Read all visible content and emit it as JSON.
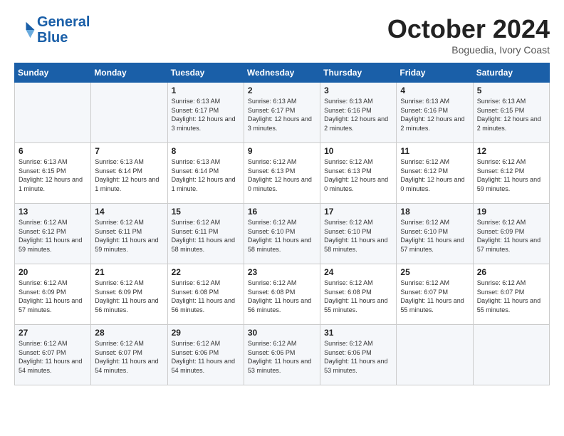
{
  "header": {
    "logo_line1": "General",
    "logo_line2": "Blue",
    "month": "October 2024",
    "location": "Boguedia, Ivory Coast"
  },
  "days_of_week": [
    "Sunday",
    "Monday",
    "Tuesday",
    "Wednesday",
    "Thursday",
    "Friday",
    "Saturday"
  ],
  "weeks": [
    [
      {
        "day": "",
        "info": ""
      },
      {
        "day": "",
        "info": ""
      },
      {
        "day": "1",
        "info": "Sunrise: 6:13 AM\nSunset: 6:17 PM\nDaylight: 12 hours and 3 minutes."
      },
      {
        "day": "2",
        "info": "Sunrise: 6:13 AM\nSunset: 6:17 PM\nDaylight: 12 hours and 3 minutes."
      },
      {
        "day": "3",
        "info": "Sunrise: 6:13 AM\nSunset: 6:16 PM\nDaylight: 12 hours and 2 minutes."
      },
      {
        "day": "4",
        "info": "Sunrise: 6:13 AM\nSunset: 6:16 PM\nDaylight: 12 hours and 2 minutes."
      },
      {
        "day": "5",
        "info": "Sunrise: 6:13 AM\nSunset: 6:15 PM\nDaylight: 12 hours and 2 minutes."
      }
    ],
    [
      {
        "day": "6",
        "info": "Sunrise: 6:13 AM\nSunset: 6:15 PM\nDaylight: 12 hours and 1 minute."
      },
      {
        "day": "7",
        "info": "Sunrise: 6:13 AM\nSunset: 6:14 PM\nDaylight: 12 hours and 1 minute."
      },
      {
        "day": "8",
        "info": "Sunrise: 6:13 AM\nSunset: 6:14 PM\nDaylight: 12 hours and 1 minute."
      },
      {
        "day": "9",
        "info": "Sunrise: 6:12 AM\nSunset: 6:13 PM\nDaylight: 12 hours and 0 minutes."
      },
      {
        "day": "10",
        "info": "Sunrise: 6:12 AM\nSunset: 6:13 PM\nDaylight: 12 hours and 0 minutes."
      },
      {
        "day": "11",
        "info": "Sunrise: 6:12 AM\nSunset: 6:12 PM\nDaylight: 12 hours and 0 minutes."
      },
      {
        "day": "12",
        "info": "Sunrise: 6:12 AM\nSunset: 6:12 PM\nDaylight: 11 hours and 59 minutes."
      }
    ],
    [
      {
        "day": "13",
        "info": "Sunrise: 6:12 AM\nSunset: 6:12 PM\nDaylight: 11 hours and 59 minutes."
      },
      {
        "day": "14",
        "info": "Sunrise: 6:12 AM\nSunset: 6:11 PM\nDaylight: 11 hours and 59 minutes."
      },
      {
        "day": "15",
        "info": "Sunrise: 6:12 AM\nSunset: 6:11 PM\nDaylight: 11 hours and 58 minutes."
      },
      {
        "day": "16",
        "info": "Sunrise: 6:12 AM\nSunset: 6:10 PM\nDaylight: 11 hours and 58 minutes."
      },
      {
        "day": "17",
        "info": "Sunrise: 6:12 AM\nSunset: 6:10 PM\nDaylight: 11 hours and 58 minutes."
      },
      {
        "day": "18",
        "info": "Sunrise: 6:12 AM\nSunset: 6:10 PM\nDaylight: 11 hours and 57 minutes."
      },
      {
        "day": "19",
        "info": "Sunrise: 6:12 AM\nSunset: 6:09 PM\nDaylight: 11 hours and 57 minutes."
      }
    ],
    [
      {
        "day": "20",
        "info": "Sunrise: 6:12 AM\nSunset: 6:09 PM\nDaylight: 11 hours and 57 minutes."
      },
      {
        "day": "21",
        "info": "Sunrise: 6:12 AM\nSunset: 6:09 PM\nDaylight: 11 hours and 56 minutes."
      },
      {
        "day": "22",
        "info": "Sunrise: 6:12 AM\nSunset: 6:08 PM\nDaylight: 11 hours and 56 minutes."
      },
      {
        "day": "23",
        "info": "Sunrise: 6:12 AM\nSunset: 6:08 PM\nDaylight: 11 hours and 56 minutes."
      },
      {
        "day": "24",
        "info": "Sunrise: 6:12 AM\nSunset: 6:08 PM\nDaylight: 11 hours and 55 minutes."
      },
      {
        "day": "25",
        "info": "Sunrise: 6:12 AM\nSunset: 6:07 PM\nDaylight: 11 hours and 55 minutes."
      },
      {
        "day": "26",
        "info": "Sunrise: 6:12 AM\nSunset: 6:07 PM\nDaylight: 11 hours and 55 minutes."
      }
    ],
    [
      {
        "day": "27",
        "info": "Sunrise: 6:12 AM\nSunset: 6:07 PM\nDaylight: 11 hours and 54 minutes."
      },
      {
        "day": "28",
        "info": "Sunrise: 6:12 AM\nSunset: 6:07 PM\nDaylight: 11 hours and 54 minutes."
      },
      {
        "day": "29",
        "info": "Sunrise: 6:12 AM\nSunset: 6:06 PM\nDaylight: 11 hours and 54 minutes."
      },
      {
        "day": "30",
        "info": "Sunrise: 6:12 AM\nSunset: 6:06 PM\nDaylight: 11 hours and 53 minutes."
      },
      {
        "day": "31",
        "info": "Sunrise: 6:12 AM\nSunset: 6:06 PM\nDaylight: 11 hours and 53 minutes."
      },
      {
        "day": "",
        "info": ""
      },
      {
        "day": "",
        "info": ""
      }
    ]
  ]
}
